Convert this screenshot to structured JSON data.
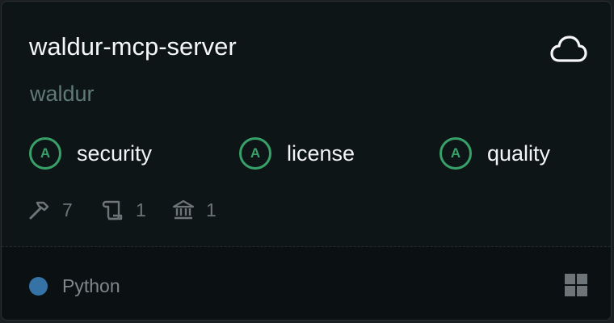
{
  "server": {
    "name": "waldur-mcp-server",
    "owner": "waldur",
    "hosting_icon": "cloud-icon"
  },
  "scores": [
    {
      "grade": "A",
      "label": "security"
    },
    {
      "grade": "A",
      "label": "license"
    },
    {
      "grade": "A",
      "label": "quality"
    }
  ],
  "stats": [
    {
      "icon": "hammer-icon",
      "count": "7"
    },
    {
      "icon": "scroll-icon",
      "count": "1"
    },
    {
      "icon": "bank-icon",
      "count": "1"
    }
  ],
  "footer": {
    "language": "Python",
    "language_color": "#3572a5",
    "platform_icon": "windows-icon"
  },
  "colors": {
    "grade_green": "#38a169",
    "background": "#0e1517"
  }
}
